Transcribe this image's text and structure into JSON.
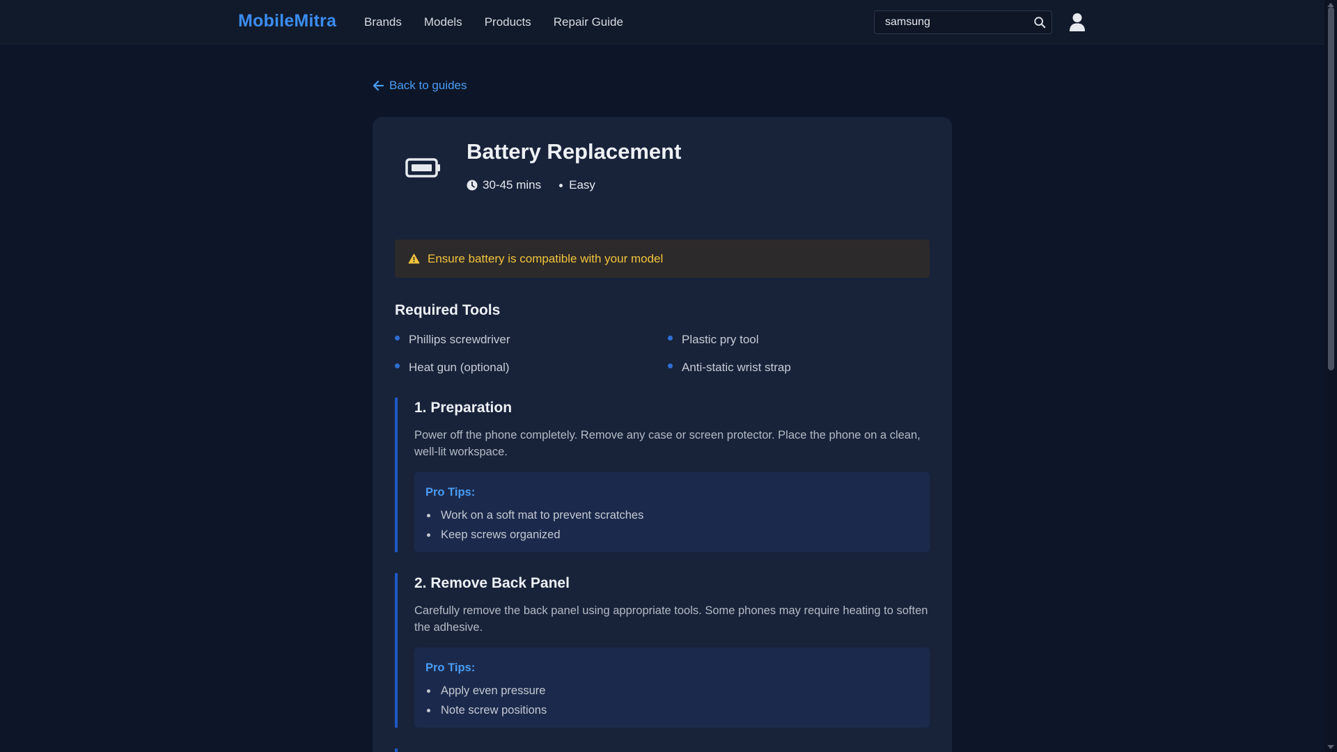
{
  "nav": {
    "logo": "MobileMitra",
    "links": [
      "Brands",
      "Models",
      "Products",
      "Repair Guide"
    ],
    "search_value": "samsung"
  },
  "back_label": "Back to guides",
  "guide": {
    "title": "Battery Replacement",
    "duration": "30-45 mins",
    "difficulty": "Easy",
    "warning": "Ensure battery is compatible with your model",
    "tools_heading": "Required Tools",
    "tools": [
      "Phillips screwdriver",
      "Plastic pry tool",
      "Heat gun (optional)",
      "Anti-static wrist strap"
    ],
    "steps": [
      {
        "title": "1. Preparation",
        "description": "Power off the phone completely. Remove any case or screen protector. Place the phone on a clean, well-lit workspace.",
        "tips_label": "Pro Tips:",
        "tips": [
          "Work on a soft mat to prevent scratches",
          "Keep screws organized"
        ]
      },
      {
        "title": "2. Remove Back Panel",
        "description": "Carefully remove the back panel using appropriate tools. Some phones may require heating to soften the adhesive.",
        "tips_label": "Pro Tips:",
        "tips": [
          "Apply even pressure",
          "Note screw positions"
        ]
      }
    ]
  },
  "colors": {
    "background": "#0d1628",
    "card": "#18233a",
    "accent": "#3b8cf0",
    "warning_text": "#f3c43e",
    "step_border": "#1e58c6"
  }
}
